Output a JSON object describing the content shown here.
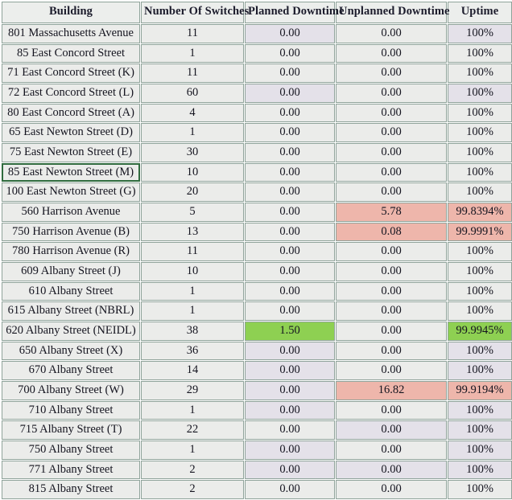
{
  "table": {
    "columns": [
      {
        "key": "building",
        "label": "Building"
      },
      {
        "key": "switches",
        "label": "Number Of Switches"
      },
      {
        "key": "planned",
        "label": "Planned Downtime"
      },
      {
        "key": "unplanned",
        "label": "Unplanned Downtime"
      },
      {
        "key": "uptime",
        "label": "Uptime"
      }
    ],
    "colors": {
      "header_bg": "#eceeec",
      "cell_bg": "#ebecea",
      "tint_bg": "#e4e1e9",
      "alert_bg": "#eeb6ab",
      "ok_bg": "#8ed052",
      "border": "#8fa39a",
      "focus_border": "#2f6b3d",
      "text": "#14141f"
    },
    "rows": [
      {
        "building": "801 Massachusetts Avenue",
        "switches": "11",
        "planned": "0.00",
        "unplanned": "0.00",
        "uptime": "100%",
        "planned_state": "tint",
        "unplanned_state": "none",
        "uptime_state": "tint",
        "focus": false
      },
      {
        "building": "85 East Concord Street",
        "switches": "1",
        "planned": "0.00",
        "unplanned": "0.00",
        "uptime": "100%",
        "planned_state": "none",
        "unplanned_state": "none",
        "uptime_state": "none",
        "focus": false
      },
      {
        "building": "71 East Concord Street (K)",
        "switches": "11",
        "planned": "0.00",
        "unplanned": "0.00",
        "uptime": "100%",
        "planned_state": "none",
        "unplanned_state": "none",
        "uptime_state": "none",
        "focus": false
      },
      {
        "building": "72 East Concord Street (L)",
        "switches": "60",
        "planned": "0.00",
        "unplanned": "0.00",
        "uptime": "100%",
        "planned_state": "tint",
        "unplanned_state": "none",
        "uptime_state": "tint",
        "focus": false
      },
      {
        "building": "80 East Concord Street (A)",
        "switches": "4",
        "planned": "0.00",
        "unplanned": "0.00",
        "uptime": "100%",
        "planned_state": "none",
        "unplanned_state": "none",
        "uptime_state": "none",
        "focus": false
      },
      {
        "building": "65 East Newton Street (D)",
        "switches": "1",
        "planned": "0.00",
        "unplanned": "0.00",
        "uptime": "100%",
        "planned_state": "none",
        "unplanned_state": "none",
        "uptime_state": "none",
        "focus": false
      },
      {
        "building": "75 East Newton Street (E)",
        "switches": "30",
        "planned": "0.00",
        "unplanned": "0.00",
        "uptime": "100%",
        "planned_state": "none",
        "unplanned_state": "none",
        "uptime_state": "none",
        "focus": false
      },
      {
        "building": "85 East Newton Street (M)",
        "switches": "10",
        "planned": "0.00",
        "unplanned": "0.00",
        "uptime": "100%",
        "planned_state": "none",
        "unplanned_state": "none",
        "uptime_state": "none",
        "focus": true
      },
      {
        "building": "100 East Newton Street (G)",
        "switches": "20",
        "planned": "0.00",
        "unplanned": "0.00",
        "uptime": "100%",
        "planned_state": "none",
        "unplanned_state": "none",
        "uptime_state": "none",
        "focus": false
      },
      {
        "building": "560 Harrison Avenue",
        "switches": "5",
        "planned": "0.00",
        "unplanned": "5.78",
        "uptime": "99.8394%",
        "planned_state": "none",
        "unplanned_state": "bad",
        "uptime_state": "bad",
        "focus": false
      },
      {
        "building": "750 Harrison Avenue (B)",
        "switches": "13",
        "planned": "0.00",
        "unplanned": "0.08",
        "uptime": "99.9991%",
        "planned_state": "none",
        "unplanned_state": "bad",
        "uptime_state": "bad",
        "focus": false
      },
      {
        "building": "780 Harrison Avenue (R)",
        "switches": "11",
        "planned": "0.00",
        "unplanned": "0.00",
        "uptime": "100%",
        "planned_state": "none",
        "unplanned_state": "none",
        "uptime_state": "none",
        "focus": false
      },
      {
        "building": "609 Albany Street (J)",
        "switches": "10",
        "planned": "0.00",
        "unplanned": "0.00",
        "uptime": "100%",
        "planned_state": "none",
        "unplanned_state": "none",
        "uptime_state": "none",
        "focus": false
      },
      {
        "building": "610 Albany Street",
        "switches": "1",
        "planned": "0.00",
        "unplanned": "0.00",
        "uptime": "100%",
        "planned_state": "none",
        "unplanned_state": "none",
        "uptime_state": "none",
        "focus": false
      },
      {
        "building": "615 Albany Street (NBRL)",
        "switches": "1",
        "planned": "0.00",
        "unplanned": "0.00",
        "uptime": "100%",
        "planned_state": "none",
        "unplanned_state": "none",
        "uptime_state": "none",
        "focus": false
      },
      {
        "building": "620 Albany Street (NEIDL)",
        "switches": "38",
        "planned": "1.50",
        "unplanned": "0.00",
        "uptime": "99.9945%",
        "planned_state": "good",
        "unplanned_state": "none",
        "uptime_state": "good",
        "focus": false
      },
      {
        "building": "650 Albany Street (X)",
        "switches": "36",
        "planned": "0.00",
        "unplanned": "0.00",
        "uptime": "100%",
        "planned_state": "tint",
        "unplanned_state": "none",
        "uptime_state": "tint",
        "focus": false
      },
      {
        "building": "670 Albany Street",
        "switches": "14",
        "planned": "0.00",
        "unplanned": "0.00",
        "uptime": "100%",
        "planned_state": "tint",
        "unplanned_state": "none",
        "uptime_state": "tint",
        "focus": false
      },
      {
        "building": "700 Albany Street (W)",
        "switches": "29",
        "planned": "0.00",
        "unplanned": "16.82",
        "uptime": "99.9194%",
        "planned_state": "tint",
        "unplanned_state": "bad",
        "uptime_state": "bad",
        "focus": false
      },
      {
        "building": "710 Albany Street",
        "switches": "1",
        "planned": "0.00",
        "unplanned": "0.00",
        "uptime": "100%",
        "planned_state": "tint",
        "unplanned_state": "none",
        "uptime_state": "tint",
        "focus": false
      },
      {
        "building": "715 Albany Street (T)",
        "switches": "22",
        "planned": "0.00",
        "unplanned": "0.00",
        "uptime": "100%",
        "planned_state": "none",
        "unplanned_state": "tint",
        "uptime_state": "tint",
        "focus": false
      },
      {
        "building": "750 Albany Street",
        "switches": "1",
        "planned": "0.00",
        "unplanned": "0.00",
        "uptime": "100%",
        "planned_state": "tint",
        "unplanned_state": "none",
        "uptime_state": "tint",
        "focus": false
      },
      {
        "building": "771 Albany Street",
        "switches": "2",
        "planned": "0.00",
        "unplanned": "0.00",
        "uptime": "100%",
        "planned_state": "tint",
        "unplanned_state": "tint",
        "uptime_state": "tint",
        "focus": false
      },
      {
        "building": "815 Albany Street",
        "switches": "2",
        "planned": "0.00",
        "unplanned": "0.00",
        "uptime": "100%",
        "planned_state": "none",
        "unplanned_state": "none",
        "uptime_state": "none",
        "focus": false
      }
    ]
  }
}
